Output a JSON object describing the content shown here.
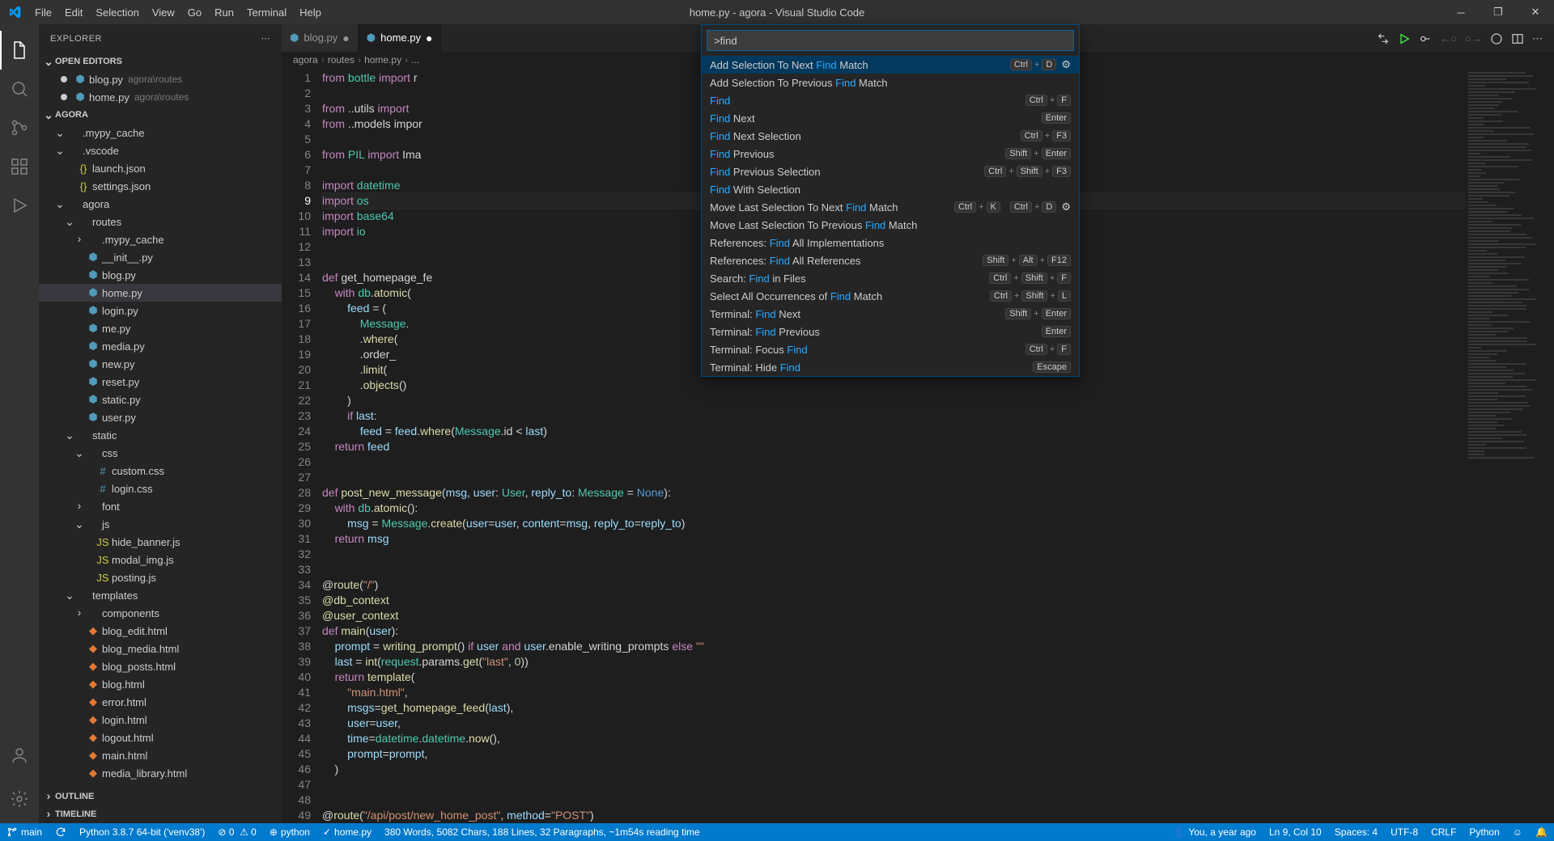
{
  "window": {
    "title": "home.py - agora - Visual Studio Code"
  },
  "menu": [
    "File",
    "Edit",
    "Selection",
    "View",
    "Go",
    "Run",
    "Terminal",
    "Help"
  ],
  "explorer": {
    "title": "EXPLORER",
    "sections": {
      "openEditors": "OPEN EDITORS",
      "project": "AGORA",
      "outline": "OUTLINE",
      "timeline": "TIMELINE"
    },
    "openEditors": [
      {
        "name": "blog.py",
        "desc": "agora\\routes",
        "modified": true
      },
      {
        "name": "home.py",
        "desc": "agora\\routes",
        "modified": true
      }
    ],
    "tree": [
      {
        "d": 1,
        "t": "folder-open",
        "n": ".mypy_cache"
      },
      {
        "d": 1,
        "t": "folder-open",
        "n": ".vscode"
      },
      {
        "d": 2,
        "t": "json",
        "n": "launch.json"
      },
      {
        "d": 2,
        "t": "json",
        "n": "settings.json"
      },
      {
        "d": 1,
        "t": "folder-open",
        "n": "agora"
      },
      {
        "d": 2,
        "t": "folder-open",
        "n": "routes"
      },
      {
        "d": 3,
        "t": "folder-closed",
        "n": ".mypy_cache"
      },
      {
        "d": 3,
        "t": "py",
        "n": "__init__.py"
      },
      {
        "d": 3,
        "t": "py",
        "n": "blog.py"
      },
      {
        "d": 3,
        "t": "py",
        "n": "home.py",
        "selected": true
      },
      {
        "d": 3,
        "t": "py",
        "n": "login.py"
      },
      {
        "d": 3,
        "t": "py",
        "n": "me.py"
      },
      {
        "d": 3,
        "t": "py",
        "n": "media.py"
      },
      {
        "d": 3,
        "t": "py",
        "n": "new.py"
      },
      {
        "d": 3,
        "t": "py",
        "n": "reset.py"
      },
      {
        "d": 3,
        "t": "py",
        "n": "static.py"
      },
      {
        "d": 3,
        "t": "py",
        "n": "user.py"
      },
      {
        "d": 2,
        "t": "folder-open",
        "n": "static"
      },
      {
        "d": 3,
        "t": "folder-open",
        "n": "css"
      },
      {
        "d": 4,
        "t": "css",
        "n": "custom.css"
      },
      {
        "d": 4,
        "t": "css",
        "n": "login.css"
      },
      {
        "d": 3,
        "t": "folder-closed",
        "n": "font"
      },
      {
        "d": 3,
        "t": "folder-open",
        "n": "js"
      },
      {
        "d": 4,
        "t": "js",
        "n": "hide_banner.js"
      },
      {
        "d": 4,
        "t": "js",
        "n": "modal_img.js"
      },
      {
        "d": 4,
        "t": "js",
        "n": "posting.js"
      },
      {
        "d": 2,
        "t": "folder-open",
        "n": "templates"
      },
      {
        "d": 3,
        "t": "folder-closed",
        "n": "components"
      },
      {
        "d": 3,
        "t": "html",
        "n": "blog_edit.html"
      },
      {
        "d": 3,
        "t": "html",
        "n": "blog_media.html"
      },
      {
        "d": 3,
        "t": "html",
        "n": "blog_posts.html"
      },
      {
        "d": 3,
        "t": "html",
        "n": "blog.html"
      },
      {
        "d": 3,
        "t": "html",
        "n": "error.html"
      },
      {
        "d": 3,
        "t": "html",
        "n": "login.html"
      },
      {
        "d": 3,
        "t": "html",
        "n": "logout.html"
      },
      {
        "d": 3,
        "t": "html",
        "n": "main.html"
      },
      {
        "d": 3,
        "t": "html",
        "n": "media_library.html"
      }
    ]
  },
  "tabs": [
    {
      "name": "blog.py",
      "modified": true,
      "active": false
    },
    {
      "name": "home.py",
      "modified": true,
      "active": true
    }
  ],
  "breadcrumbs": [
    "agora",
    "routes",
    "home.py",
    "..."
  ],
  "palette": {
    "query": ">find",
    "items": [
      {
        "pre": "Add Selection To Next ",
        "hi": "Find",
        "post": " Match",
        "keys": [
          [
            "Ctrl",
            "D"
          ]
        ],
        "gear": true,
        "sel": true
      },
      {
        "pre": "Add Selection To Previous ",
        "hi": "Find",
        "post": " Match",
        "keys": []
      },
      {
        "pre": "",
        "hi": "Find",
        "post": "",
        "keys": [
          [
            "Ctrl",
            "F"
          ]
        ]
      },
      {
        "pre": "",
        "hi": "Find",
        "post": " Next",
        "keys": [
          [
            "Enter"
          ]
        ]
      },
      {
        "pre": "",
        "hi": "Find",
        "post": " Next Selection",
        "keys": [
          [
            "Ctrl",
            "F3"
          ]
        ]
      },
      {
        "pre": "",
        "hi": "Find",
        "post": " Previous",
        "keys": [
          [
            "Shift",
            "Enter"
          ]
        ]
      },
      {
        "pre": "",
        "hi": "Find",
        "post": " Previous Selection",
        "keys": [
          [
            "Ctrl",
            "Shift",
            "F3"
          ]
        ]
      },
      {
        "pre": "",
        "hi": "Find",
        "post": " With Selection",
        "keys": []
      },
      {
        "pre": "Move Last Selection To Next ",
        "hi": "Find",
        "post": " Match",
        "keys": [
          [
            "Ctrl",
            "K"
          ],
          [
            "Ctrl",
            "D"
          ]
        ],
        "gear": true
      },
      {
        "pre": "Move Last Selection To Previous ",
        "hi": "Find",
        "post": " Match",
        "keys": []
      },
      {
        "pre": "References: ",
        "hi": "Find",
        "post": " All Implementations",
        "keys": []
      },
      {
        "pre": "References: ",
        "hi": "Find",
        "post": " All References",
        "keys": [
          [
            "Shift",
            "Alt",
            "F12"
          ]
        ]
      },
      {
        "pre": "Search: ",
        "hi": "Find",
        "post": " in Files",
        "keys": [
          [
            "Ctrl",
            "Shift",
            "F"
          ]
        ]
      },
      {
        "pre": "Select All Occurrences of ",
        "hi": "Find",
        "post": " Match",
        "keys": [
          [
            "Ctrl",
            "Shift",
            "L"
          ]
        ]
      },
      {
        "pre": "Terminal: ",
        "hi": "Find",
        "post": " Next",
        "keys": [
          [
            "Shift",
            "Enter"
          ]
        ]
      },
      {
        "pre": "Terminal: ",
        "hi": "Find",
        "post": " Previous",
        "keys": [
          [
            "Enter"
          ]
        ]
      },
      {
        "pre": "Terminal: Focus ",
        "hi": "Find",
        "post": "",
        "keys": [
          [
            "Ctrl",
            "F"
          ]
        ]
      },
      {
        "pre": "Terminal: Hide ",
        "hi": "Find",
        "post": "",
        "keys": [
          [
            "Escape"
          ]
        ]
      }
    ]
  },
  "code": {
    "currentLine": 9,
    "lines": [
      "from bottle import r",
      "",
      "from ..utils import",
      "from ..models impor",
      "",
      "from PIL import Ima",
      "",
      "import datetime",
      "import os",
      "import base64",
      "import io",
      "",
      "",
      "def get_homepage_fe",
      "    with db.atomic(",
      "        feed = (",
      "            Message.",
      "            .where(",
      "            .order_",
      "            .limit(",
      "            .objects()",
      "        )",
      "        if last:",
      "            feed = feed.where(Message.id < last)",
      "    return feed",
      "",
      "",
      "def post_new_message(msg, user: User, reply_to: Message = None):",
      "    with db.atomic():",
      "        msg = Message.create(user=user, content=msg, reply_to=reply_to)",
      "    return msg",
      "",
      "",
      "@route(\"/\")",
      "@db_context",
      "@user_context",
      "def main(user):",
      "    prompt = writing_prompt() if user and user.enable_writing_prompts else \"\"",
      "    last = int(request.params.get(\"last\", 0))",
      "    return template(",
      "        \"main.html\",",
      "        msgs=get_homepage_feed(last),",
      "        user=user,",
      "        time=datetime.datetime.now(),",
      "        prompt=prompt,",
      "    )",
      "",
      "",
      "@route(\"/api/post/new_home_post\", method=\"POST\")"
    ]
  },
  "status": {
    "branch": "main",
    "python": "Python 3.8.7 64-bit ('venv38')",
    "problems": "0 ⚠ 0",
    "interp": "python",
    "file": "home.py",
    "stats": "380 Words, 5082 Chars, 188 Lines, 32 Paragraphs, ~1m54s reading time",
    "blame": "You, a year ago",
    "pos": "Ln 9, Col 10",
    "spaces": "Spaces: 4",
    "enc": "UTF-8",
    "eol": "CRLF",
    "lang": "Python"
  }
}
